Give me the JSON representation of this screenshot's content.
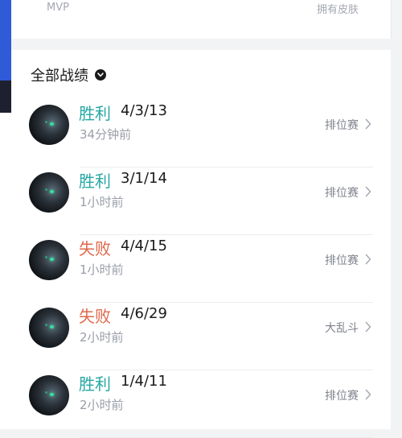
{
  "top": {
    "left_label": "MVP",
    "right_label": "拥有皮肤"
  },
  "section": {
    "title": "全部战绩"
  },
  "matches": [
    {
      "result": "胜利",
      "outcome": "win",
      "kda": "4/3/13",
      "time": "34分钟前",
      "mode": "排位赛"
    },
    {
      "result": "胜利",
      "outcome": "win",
      "kda": "3/1/14",
      "time": "1小时前",
      "mode": "排位赛"
    },
    {
      "result": "失败",
      "outcome": "loss",
      "kda": "4/4/15",
      "time": "1小时前",
      "mode": "排位赛"
    },
    {
      "result": "失败",
      "outcome": "loss",
      "kda": "4/6/29",
      "time": "2小时前",
      "mode": "大乱斗"
    },
    {
      "result": "胜利",
      "outcome": "win",
      "kda": "1/4/11",
      "time": "2小时前",
      "mode": "排位赛"
    }
  ],
  "colors": {
    "win": "#25a8a4",
    "loss": "#e0684b",
    "muted": "#9a9ea8"
  }
}
